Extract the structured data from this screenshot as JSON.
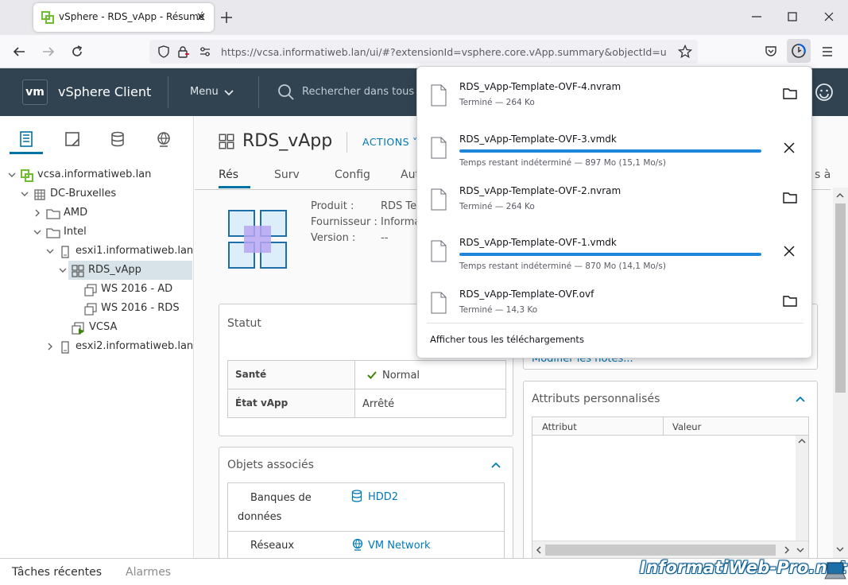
{
  "browser": {
    "tab_title": "vSphere - RDS_vApp - Résumé",
    "url": "https://vcsa.informatiweb.lan/ui/#?extensionId=vsphere.core.vApp.summary&objectId=urn:vm"
  },
  "header": {
    "logo": "vm",
    "app_title": "vSphere Client",
    "menu_label": "Menu",
    "search_placeholder": "Rechercher dans tous l"
  },
  "tree": {
    "root": "vcsa.informatiweb.lan",
    "datacenter": "DC-Bruxelles",
    "folder1": "AMD",
    "folder2": "Intel",
    "host1": "esxi1.informatiweb.lan",
    "vapp": "RDS_vApp",
    "vm1": "WS 2016 - AD",
    "vm2": "WS 2016 - RDS",
    "vm3": "VCSA",
    "host2": "esxi2.informatiweb.lan"
  },
  "main": {
    "title": "RDS_vApp",
    "actions_label": "ACTIONS",
    "tabs": [
      "Rés",
      "Surv",
      "Config",
      "Aut"
    ],
    "tab_right": "s à",
    "props": {
      "product_label": "Produit :",
      "product_value": "RDS Te",
      "vendor_label": "Fournisseur :",
      "vendor_value": "Informa",
      "version_label": "Version :",
      "version_value": "--"
    },
    "status_card": {
      "title": "Statut",
      "health_label": "Santé",
      "health_value": "Normal",
      "state_label": "État vApp",
      "state_value": "Arrêté"
    },
    "related_card": {
      "title": "Objets associés",
      "datastore_label_1": "Banques de",
      "datastore_label_2": "données",
      "datastore_value": "HDD2",
      "network_label": "Réseaux",
      "network_value": "VM Network"
    },
    "notes_link": "Modifier les notes...",
    "attributes_card": {
      "title": "Attributs personnalisés",
      "col_attribute": "Attribut",
      "col_value": "Valeur"
    }
  },
  "bottom": {
    "recent_tasks": "Tâches récentes",
    "alarms": "Alarmes"
  },
  "watermark": "InformatiWeb-Pro.net",
  "downloads": {
    "items": [
      {
        "name": "RDS_vApp-Template-OVF-4.nvram",
        "status": "Terminé — 264 Ko",
        "progress": 1.0,
        "in_progress": false
      },
      {
        "name": "RDS_vApp-Template-OVF-3.vmdk",
        "status": "Temps restant indéterminé — 897 Mo (15,1 Mo/s)",
        "progress": 1.0,
        "in_progress": true
      },
      {
        "name": "RDS_vApp-Template-OVF-2.nvram",
        "status": "Terminé — 264 Ko",
        "progress": 1.0,
        "in_progress": false
      },
      {
        "name": "RDS_vApp-Template-OVF-1.vmdk",
        "status": "Temps restant indéterminé — 870 Mo (14,1 Mo/s)",
        "progress": 1.0,
        "in_progress": true
      },
      {
        "name": "RDS_vApp-Template-OVF.ovf",
        "status": "Terminé — 14,3 Ko",
        "progress": 1.0,
        "in_progress": false
      }
    ],
    "show_all": "Afficher tous les téléchargements"
  },
  "colors": {
    "accent": "#0079b8",
    "header_bg": "#314351",
    "healthy": "#3c8500",
    "progress": "#1e86d9"
  }
}
